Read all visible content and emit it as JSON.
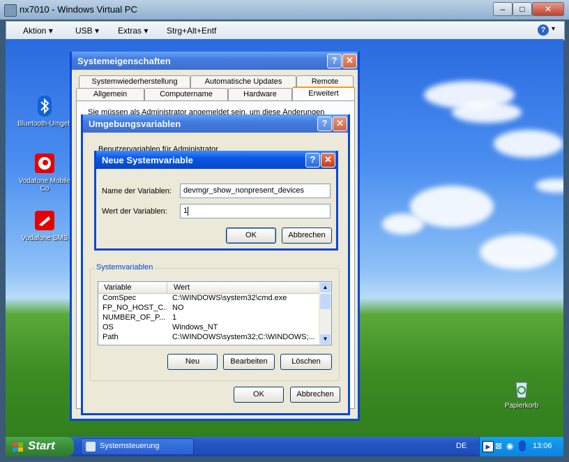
{
  "host": {
    "title": "nx7010 - Windows Virtual PC",
    "menu": [
      "Aktion",
      "USB",
      "Extras",
      "Strg+Alt+Entf"
    ],
    "window_buttons": [
      "–",
      "□",
      "✕"
    ]
  },
  "desktop_icons": [
    {
      "label": "Bluetooth-Umgeb"
    },
    {
      "label": "Vodafone Mobile Co"
    },
    {
      "label": "Vodafone SMS"
    },
    {
      "label": "Papierkorb"
    }
  ],
  "sysprops": {
    "title": "Systemeigenschaften",
    "tabs_row1": [
      "Systemwiederherstellung",
      "Automatische Updates",
      "Remote"
    ],
    "tabs_row2": [
      "Allgemein",
      "Computername",
      "Hardware",
      "Erweitert"
    ],
    "notice": "Sie müssen als Administrator angemeldet sein, um diese Änderungen"
  },
  "envvars": {
    "title": "Umgebungsvariablen",
    "user_vars_label": "Benutzervariablen für Administrator",
    "system_group_label": "Systemvariablen",
    "columns": [
      "Variable",
      "Wert"
    ],
    "rows": [
      {
        "name": "ComSpec",
        "value": "C:\\WINDOWS\\system32\\cmd.exe"
      },
      {
        "name": "FP_NO_HOST_C...",
        "value": "NO"
      },
      {
        "name": "NUMBER_OF_P...",
        "value": "1"
      },
      {
        "name": "OS",
        "value": "Windows_NT"
      },
      {
        "name": "Path",
        "value": "C:\\WINDOWS\\system32;C:\\WINDOWS;..."
      }
    ],
    "new_label": "Neu",
    "edit_label": "Bearbeiten",
    "delete_label": "Löschen",
    "ok_label": "OK",
    "cancel_label": "Abbrechen"
  },
  "newvar": {
    "title": "Neue Systemvariable",
    "name_label": "Name der Variablen:",
    "name_value": "devmgr_show_nonpresent_devices",
    "value_label": "Wert der Variablen:",
    "value_value": "1",
    "ok_label": "OK",
    "cancel_label": "Abbrechen"
  },
  "taskbar": {
    "start_label": "Start",
    "task_label": "Systemsteuerung",
    "language": "DE",
    "clock": "13:06"
  }
}
